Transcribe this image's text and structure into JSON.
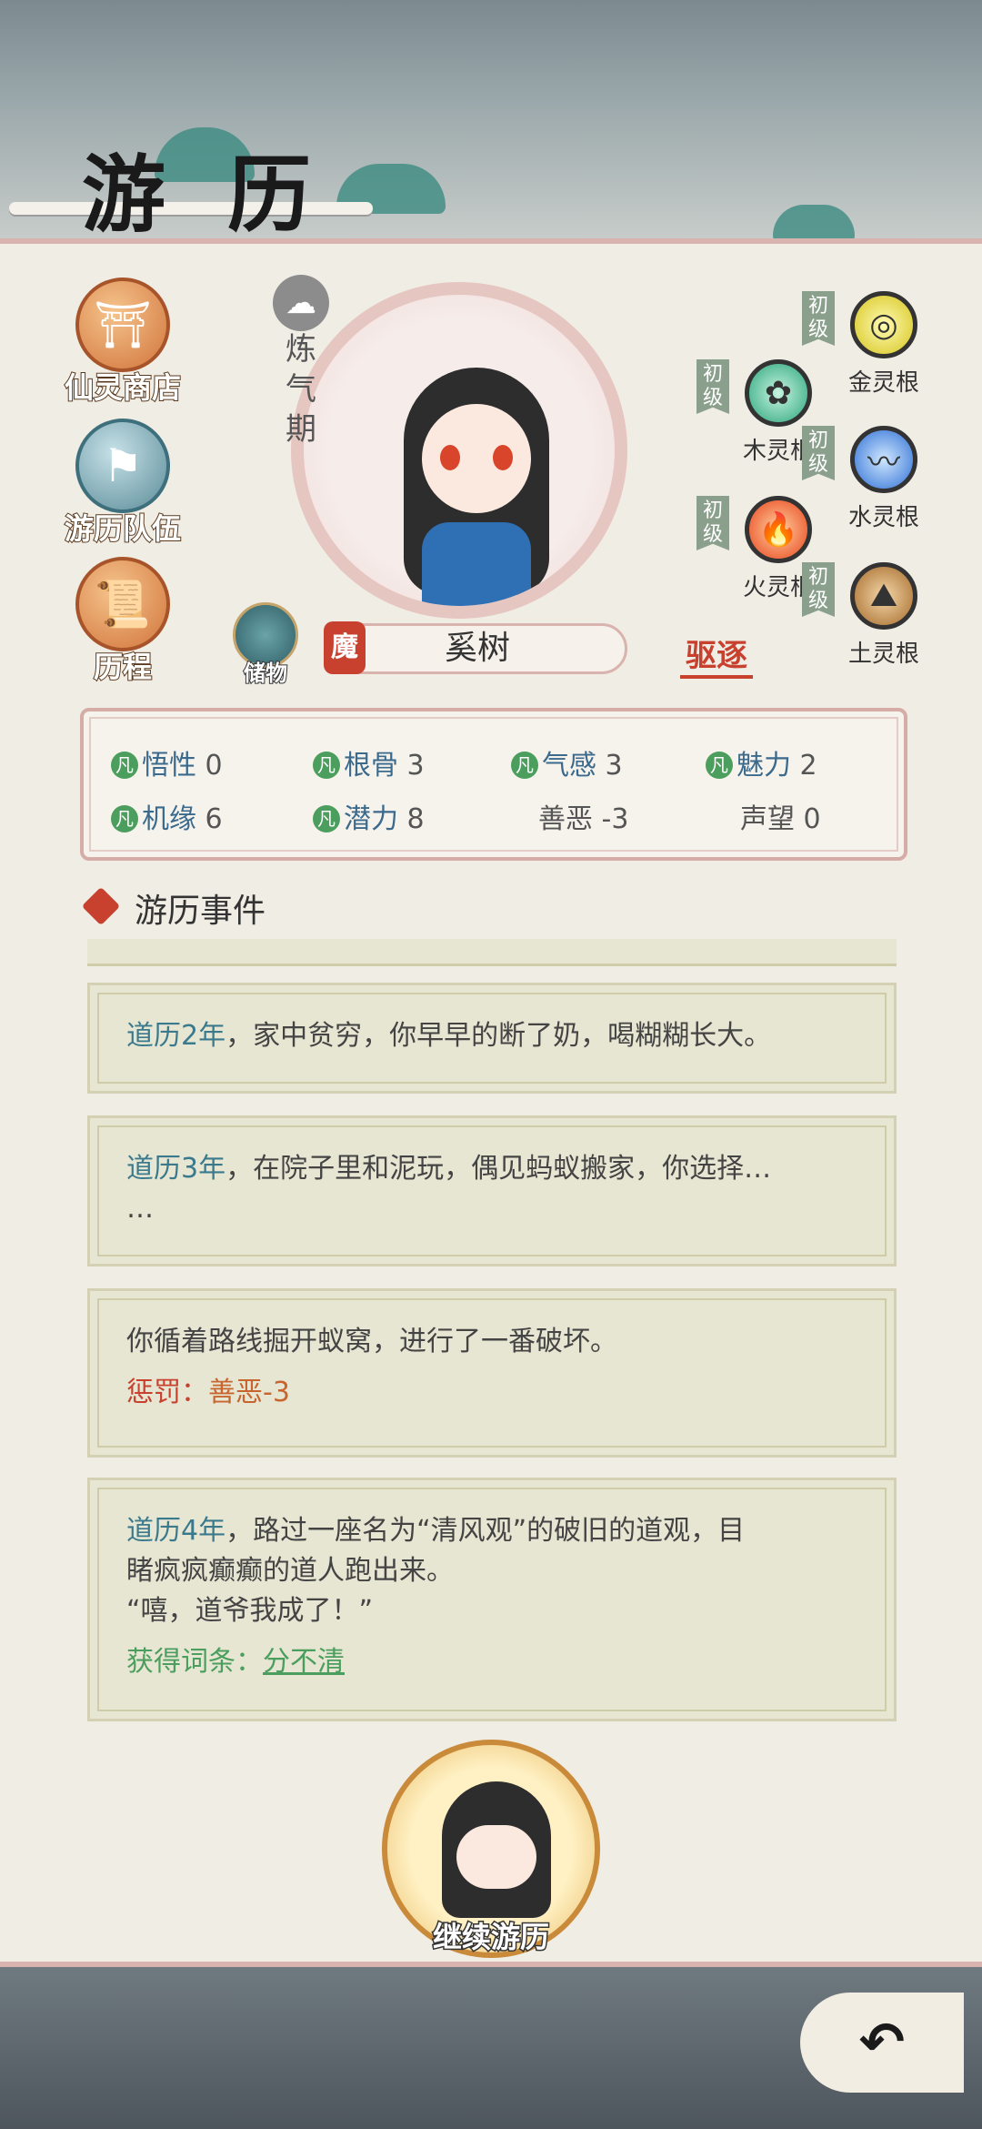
{
  "header": {
    "title": "游 历"
  },
  "side_buttons": [
    {
      "label": "仙灵商店",
      "icon": "shop-icon"
    },
    {
      "label": "游历队伍",
      "icon": "team-flag-icon"
    },
    {
      "label": "历程",
      "icon": "scroll-icon"
    }
  ],
  "character": {
    "realm": "炼气期",
    "name": "奚树",
    "demon_badge": "魔",
    "storage_label": "储物",
    "expel_label": "驱逐"
  },
  "spirit_roots": [
    {
      "grade": "初级",
      "name": "金灵根",
      "element": "gold"
    },
    {
      "grade": "初级",
      "name": "木灵根",
      "element": "wood"
    },
    {
      "grade": "初级",
      "name": "水灵根",
      "element": "water"
    },
    {
      "grade": "初级",
      "name": "火灵根",
      "element": "fire"
    },
    {
      "grade": "初级",
      "name": "土灵根",
      "element": "earth"
    }
  ],
  "stats": {
    "fan": "凡",
    "wuxing": {
      "label": "悟性",
      "value": "0"
    },
    "gengu": {
      "label": "根骨",
      "value": "3"
    },
    "qigan": {
      "label": "气感",
      "value": "3"
    },
    "meili": {
      "label": "魅力",
      "value": "2"
    },
    "jiyuan": {
      "label": "机缘",
      "value": "6"
    },
    "qianli": {
      "label": "潜力",
      "value": "8"
    },
    "shane": {
      "label": "善恶",
      "value": "-3"
    },
    "shengwang": {
      "label": "声望",
      "value": "0"
    }
  },
  "events": {
    "title": "游历事件",
    "e1": {
      "year": "道历2年",
      "text": "，家中贫穷，你早早的断了奶，喝糊糊长大。"
    },
    "e2": {
      "year": "道历3年",
      "text": "，在院子里和泥玩，偶见蚂蚁搬家，你选择…",
      "text2": "…"
    },
    "e3": {
      "text": "你循着路线掘开蚁窝，进行了一番破坏。",
      "penalty_label": "惩罚：",
      "penalty_value": "善恶-3"
    },
    "e4": {
      "year": "道历4年",
      "text": "，路过一座名为“清风观”的破旧的道观，目",
      "text2": "睹疯疯癫癫的道人跑出来。",
      "quote": "“嘻，道爷我成了！”",
      "gain_label": "获得词条：",
      "gain_value": "分不清"
    }
  },
  "continue_label": "继续游历",
  "back_icon": "back-arrow-icon",
  "colors": {
    "panel_border": "#d9b3ad",
    "accent_red": "#c8412f",
    "accent_green": "#4b9e5d",
    "year_blue": "#3b7a8d"
  }
}
